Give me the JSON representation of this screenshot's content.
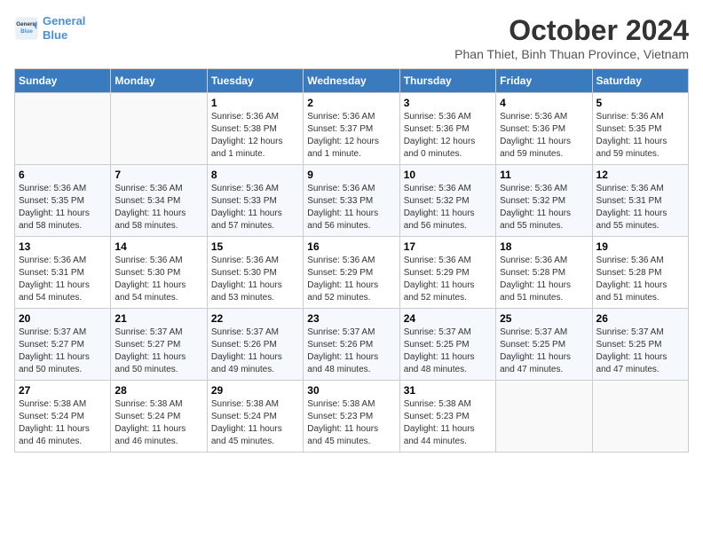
{
  "logo": {
    "line1": "General",
    "line2": "Blue"
  },
  "title": "October 2024",
  "subtitle": "Phan Thiet, Binh Thuan Province, Vietnam",
  "weekdays": [
    "Sunday",
    "Monday",
    "Tuesday",
    "Wednesday",
    "Thursday",
    "Friday",
    "Saturday"
  ],
  "weeks": [
    [
      {
        "day": "",
        "info": ""
      },
      {
        "day": "",
        "info": ""
      },
      {
        "day": "1",
        "info": "Sunrise: 5:36 AM\nSunset: 5:38 PM\nDaylight: 12 hours\nand 1 minute."
      },
      {
        "day": "2",
        "info": "Sunrise: 5:36 AM\nSunset: 5:37 PM\nDaylight: 12 hours\nand 1 minute."
      },
      {
        "day": "3",
        "info": "Sunrise: 5:36 AM\nSunset: 5:36 PM\nDaylight: 12 hours\nand 0 minutes."
      },
      {
        "day": "4",
        "info": "Sunrise: 5:36 AM\nSunset: 5:36 PM\nDaylight: 11 hours\nand 59 minutes."
      },
      {
        "day": "5",
        "info": "Sunrise: 5:36 AM\nSunset: 5:35 PM\nDaylight: 11 hours\nand 59 minutes."
      }
    ],
    [
      {
        "day": "6",
        "info": "Sunrise: 5:36 AM\nSunset: 5:35 PM\nDaylight: 11 hours\nand 58 minutes."
      },
      {
        "day": "7",
        "info": "Sunrise: 5:36 AM\nSunset: 5:34 PM\nDaylight: 11 hours\nand 58 minutes."
      },
      {
        "day": "8",
        "info": "Sunrise: 5:36 AM\nSunset: 5:33 PM\nDaylight: 11 hours\nand 57 minutes."
      },
      {
        "day": "9",
        "info": "Sunrise: 5:36 AM\nSunset: 5:33 PM\nDaylight: 11 hours\nand 56 minutes."
      },
      {
        "day": "10",
        "info": "Sunrise: 5:36 AM\nSunset: 5:32 PM\nDaylight: 11 hours\nand 56 minutes."
      },
      {
        "day": "11",
        "info": "Sunrise: 5:36 AM\nSunset: 5:32 PM\nDaylight: 11 hours\nand 55 minutes."
      },
      {
        "day": "12",
        "info": "Sunrise: 5:36 AM\nSunset: 5:31 PM\nDaylight: 11 hours\nand 55 minutes."
      }
    ],
    [
      {
        "day": "13",
        "info": "Sunrise: 5:36 AM\nSunset: 5:31 PM\nDaylight: 11 hours\nand 54 minutes."
      },
      {
        "day": "14",
        "info": "Sunrise: 5:36 AM\nSunset: 5:30 PM\nDaylight: 11 hours\nand 54 minutes."
      },
      {
        "day": "15",
        "info": "Sunrise: 5:36 AM\nSunset: 5:30 PM\nDaylight: 11 hours\nand 53 minutes."
      },
      {
        "day": "16",
        "info": "Sunrise: 5:36 AM\nSunset: 5:29 PM\nDaylight: 11 hours\nand 52 minutes."
      },
      {
        "day": "17",
        "info": "Sunrise: 5:36 AM\nSunset: 5:29 PM\nDaylight: 11 hours\nand 52 minutes."
      },
      {
        "day": "18",
        "info": "Sunrise: 5:36 AM\nSunset: 5:28 PM\nDaylight: 11 hours\nand 51 minutes."
      },
      {
        "day": "19",
        "info": "Sunrise: 5:36 AM\nSunset: 5:28 PM\nDaylight: 11 hours\nand 51 minutes."
      }
    ],
    [
      {
        "day": "20",
        "info": "Sunrise: 5:37 AM\nSunset: 5:27 PM\nDaylight: 11 hours\nand 50 minutes."
      },
      {
        "day": "21",
        "info": "Sunrise: 5:37 AM\nSunset: 5:27 PM\nDaylight: 11 hours\nand 50 minutes."
      },
      {
        "day": "22",
        "info": "Sunrise: 5:37 AM\nSunset: 5:26 PM\nDaylight: 11 hours\nand 49 minutes."
      },
      {
        "day": "23",
        "info": "Sunrise: 5:37 AM\nSunset: 5:26 PM\nDaylight: 11 hours\nand 48 minutes."
      },
      {
        "day": "24",
        "info": "Sunrise: 5:37 AM\nSunset: 5:25 PM\nDaylight: 11 hours\nand 48 minutes."
      },
      {
        "day": "25",
        "info": "Sunrise: 5:37 AM\nSunset: 5:25 PM\nDaylight: 11 hours\nand 47 minutes."
      },
      {
        "day": "26",
        "info": "Sunrise: 5:37 AM\nSunset: 5:25 PM\nDaylight: 11 hours\nand 47 minutes."
      }
    ],
    [
      {
        "day": "27",
        "info": "Sunrise: 5:38 AM\nSunset: 5:24 PM\nDaylight: 11 hours\nand 46 minutes."
      },
      {
        "day": "28",
        "info": "Sunrise: 5:38 AM\nSunset: 5:24 PM\nDaylight: 11 hours\nand 46 minutes."
      },
      {
        "day": "29",
        "info": "Sunrise: 5:38 AM\nSunset: 5:24 PM\nDaylight: 11 hours\nand 45 minutes."
      },
      {
        "day": "30",
        "info": "Sunrise: 5:38 AM\nSunset: 5:23 PM\nDaylight: 11 hours\nand 45 minutes."
      },
      {
        "day": "31",
        "info": "Sunrise: 5:38 AM\nSunset: 5:23 PM\nDaylight: 11 hours\nand 44 minutes."
      },
      {
        "day": "",
        "info": ""
      },
      {
        "day": "",
        "info": ""
      }
    ]
  ]
}
